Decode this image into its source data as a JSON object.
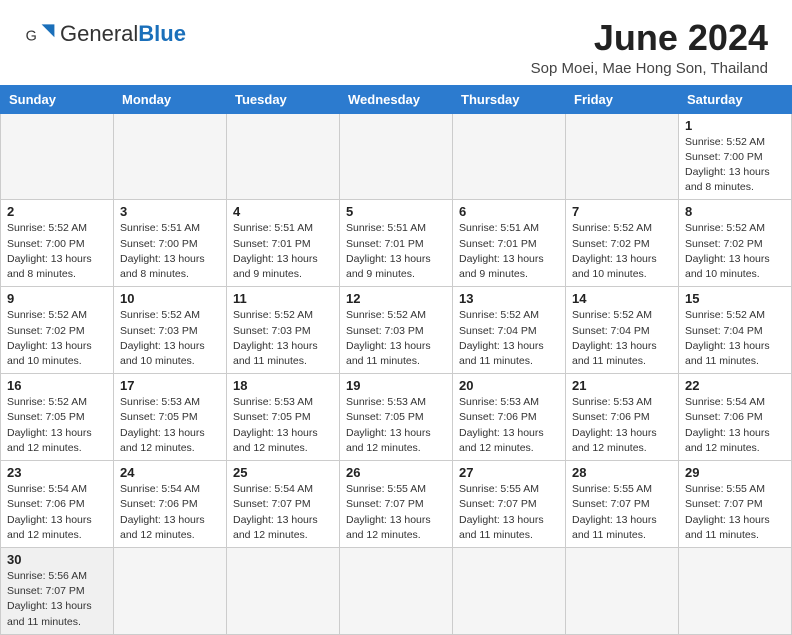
{
  "header": {
    "logo_general": "General",
    "logo_blue": "Blue",
    "month_title": "June 2024",
    "location": "Sop Moei, Mae Hong Son, Thailand"
  },
  "days_of_week": [
    "Sunday",
    "Monday",
    "Tuesday",
    "Wednesday",
    "Thursday",
    "Friday",
    "Saturday"
  ],
  "weeks": [
    [
      {
        "day": "",
        "info": ""
      },
      {
        "day": "",
        "info": ""
      },
      {
        "day": "",
        "info": ""
      },
      {
        "day": "",
        "info": ""
      },
      {
        "day": "",
        "info": ""
      },
      {
        "day": "",
        "info": ""
      },
      {
        "day": "1",
        "info": "Sunrise: 5:52 AM\nSunset: 7:00 PM\nDaylight: 13 hours and 8 minutes."
      }
    ],
    [
      {
        "day": "2",
        "info": "Sunrise: 5:52 AM\nSunset: 7:00 PM\nDaylight: 13 hours and 8 minutes."
      },
      {
        "day": "3",
        "info": "Sunrise: 5:51 AM\nSunset: 7:00 PM\nDaylight: 13 hours and 8 minutes."
      },
      {
        "day": "4",
        "info": "Sunrise: 5:51 AM\nSunset: 7:01 PM\nDaylight: 13 hours and 9 minutes."
      },
      {
        "day": "5",
        "info": "Sunrise: 5:51 AM\nSunset: 7:01 PM\nDaylight: 13 hours and 9 minutes."
      },
      {
        "day": "6",
        "info": "Sunrise: 5:51 AM\nSunset: 7:01 PM\nDaylight: 13 hours and 9 minutes."
      },
      {
        "day": "7",
        "info": "Sunrise: 5:52 AM\nSunset: 7:02 PM\nDaylight: 13 hours and 10 minutes."
      },
      {
        "day": "8",
        "info": "Sunrise: 5:52 AM\nSunset: 7:02 PM\nDaylight: 13 hours and 10 minutes."
      }
    ],
    [
      {
        "day": "9",
        "info": "Sunrise: 5:52 AM\nSunset: 7:02 PM\nDaylight: 13 hours and 10 minutes."
      },
      {
        "day": "10",
        "info": "Sunrise: 5:52 AM\nSunset: 7:03 PM\nDaylight: 13 hours and 10 minutes."
      },
      {
        "day": "11",
        "info": "Sunrise: 5:52 AM\nSunset: 7:03 PM\nDaylight: 13 hours and 11 minutes."
      },
      {
        "day": "12",
        "info": "Sunrise: 5:52 AM\nSunset: 7:03 PM\nDaylight: 13 hours and 11 minutes."
      },
      {
        "day": "13",
        "info": "Sunrise: 5:52 AM\nSunset: 7:04 PM\nDaylight: 13 hours and 11 minutes."
      },
      {
        "day": "14",
        "info": "Sunrise: 5:52 AM\nSunset: 7:04 PM\nDaylight: 13 hours and 11 minutes."
      },
      {
        "day": "15",
        "info": "Sunrise: 5:52 AM\nSunset: 7:04 PM\nDaylight: 13 hours and 11 minutes."
      }
    ],
    [
      {
        "day": "16",
        "info": "Sunrise: 5:52 AM\nSunset: 7:05 PM\nDaylight: 13 hours and 12 minutes."
      },
      {
        "day": "17",
        "info": "Sunrise: 5:53 AM\nSunset: 7:05 PM\nDaylight: 13 hours and 12 minutes."
      },
      {
        "day": "18",
        "info": "Sunrise: 5:53 AM\nSunset: 7:05 PM\nDaylight: 13 hours and 12 minutes."
      },
      {
        "day": "19",
        "info": "Sunrise: 5:53 AM\nSunset: 7:05 PM\nDaylight: 13 hours and 12 minutes."
      },
      {
        "day": "20",
        "info": "Sunrise: 5:53 AM\nSunset: 7:06 PM\nDaylight: 13 hours and 12 minutes."
      },
      {
        "day": "21",
        "info": "Sunrise: 5:53 AM\nSunset: 7:06 PM\nDaylight: 13 hours and 12 minutes."
      },
      {
        "day": "22",
        "info": "Sunrise: 5:54 AM\nSunset: 7:06 PM\nDaylight: 13 hours and 12 minutes."
      }
    ],
    [
      {
        "day": "23",
        "info": "Sunrise: 5:54 AM\nSunset: 7:06 PM\nDaylight: 13 hours and 12 minutes."
      },
      {
        "day": "24",
        "info": "Sunrise: 5:54 AM\nSunset: 7:06 PM\nDaylight: 13 hours and 12 minutes."
      },
      {
        "day": "25",
        "info": "Sunrise: 5:54 AM\nSunset: 7:07 PM\nDaylight: 13 hours and 12 minutes."
      },
      {
        "day": "26",
        "info": "Sunrise: 5:55 AM\nSunset: 7:07 PM\nDaylight: 13 hours and 12 minutes."
      },
      {
        "day": "27",
        "info": "Sunrise: 5:55 AM\nSunset: 7:07 PM\nDaylight: 13 hours and 11 minutes."
      },
      {
        "day": "28",
        "info": "Sunrise: 5:55 AM\nSunset: 7:07 PM\nDaylight: 13 hours and 11 minutes."
      },
      {
        "day": "29",
        "info": "Sunrise: 5:55 AM\nSunset: 7:07 PM\nDaylight: 13 hours and 11 minutes."
      }
    ],
    [
      {
        "day": "30",
        "info": "Sunrise: 5:56 AM\nSunset: 7:07 PM\nDaylight: 13 hours and 11 minutes."
      },
      {
        "day": "",
        "info": ""
      },
      {
        "day": "",
        "info": ""
      },
      {
        "day": "",
        "info": ""
      },
      {
        "day": "",
        "info": ""
      },
      {
        "day": "",
        "info": ""
      },
      {
        "day": "",
        "info": ""
      }
    ]
  ]
}
